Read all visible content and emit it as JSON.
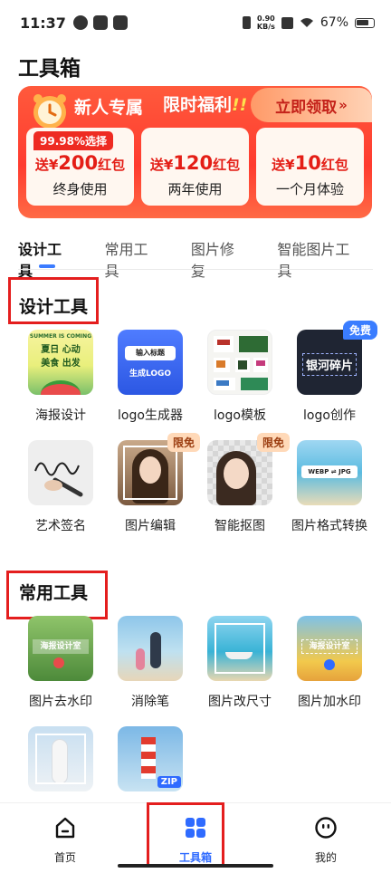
{
  "status_bar": {
    "time": "11:37",
    "net_speed_value": "0.90",
    "net_speed_unit": "KB/s",
    "battery": "67%"
  },
  "page_title": "工具箱",
  "banner": {
    "title": "新人专属",
    "badge": "限时福利",
    "badge_mark": "!!",
    "claim_label": "立即领取",
    "claim_chevron": "»",
    "coupons": [
      {
        "tag": "99.98%选择",
        "amount_prefix": "送¥",
        "amount": "200",
        "amount_suffix": "红包",
        "term": "终身使用"
      },
      {
        "tag": "",
        "amount_prefix": "送¥",
        "amount": "120",
        "amount_suffix": "红包",
        "term": "两年使用"
      },
      {
        "tag": "",
        "amount_prefix": "送¥",
        "amount": "10",
        "amount_suffix": "红包",
        "term": "一个月体验"
      }
    ]
  },
  "tabs": [
    "设计工具",
    "常用工具",
    "图片修复",
    "智能图片工具"
  ],
  "design_section": {
    "title": "设计工具",
    "tools": [
      {
        "label": "海报设计",
        "thumb_lines": [
          "SUMMER IS COMING",
          "夏日  心动",
          "美食  出发"
        ]
      },
      {
        "label": "logo生成器",
        "thumb_lines": [
          "输入标题",
          "生成LOGO"
        ]
      },
      {
        "label": "logo模板",
        "thumb_lines": []
      },
      {
        "label": "logo创作",
        "badge": "免费",
        "thumb_lines": [
          "银河碎片"
        ]
      },
      {
        "label": "艺术签名",
        "thumb_lines": []
      },
      {
        "label": "图片编辑",
        "badge": "限免",
        "thumb_lines": []
      },
      {
        "label": "智能抠图",
        "badge": "限免",
        "thumb_lines": []
      },
      {
        "label": "图片格式转换",
        "thumb_lines": [
          "WEBP ⇌ JPG"
        ]
      }
    ]
  },
  "common_section": {
    "title": "常用工具",
    "tools": [
      {
        "label": "图片去水印",
        "thumb_lines": [
          "海报设计室"
        ]
      },
      {
        "label": "消除笔",
        "thumb_lines": []
      },
      {
        "label": "图片改尺寸",
        "thumb_lines": []
      },
      {
        "label": "图片加水印",
        "thumb_lines": [
          "海报设计室"
        ]
      },
      {
        "label": "",
        "thumb_lines": []
      },
      {
        "label": "",
        "thumb_lines": [
          "ZIP"
        ]
      }
    ]
  },
  "bottom_nav": {
    "items": [
      {
        "label": "首页",
        "icon": "home-icon"
      },
      {
        "label": "工具箱",
        "icon": "toolbox-icon"
      },
      {
        "label": "我的",
        "icon": "profile-icon"
      }
    ]
  },
  "colors": {
    "accent_blue": "#2f6bff",
    "banner_red": "#ff3b2f",
    "highlight_red": "#e41e1e"
  }
}
